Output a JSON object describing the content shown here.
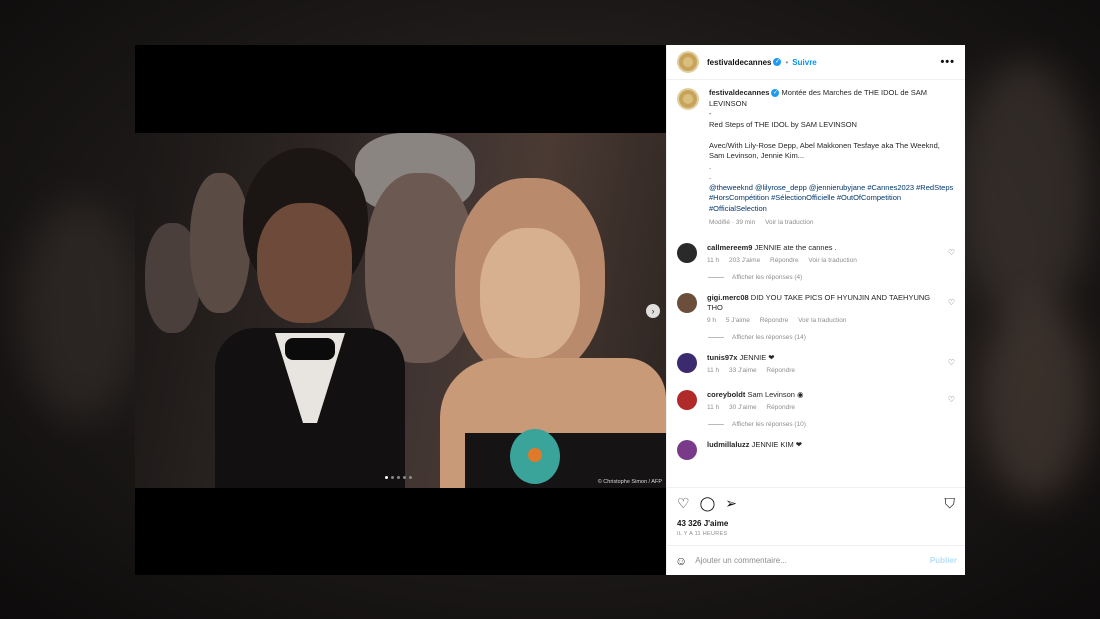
{
  "post": {
    "account": "festivaldecannes",
    "follow_label": "Suivre",
    "more_label": "•••",
    "photo_credit": "© Christophe Simon / AFP"
  },
  "caption": {
    "username": "festivaldecannes",
    "line1": " Montée des Marches de THE IDOL de SAM LEVINSON",
    "sep1": "-",
    "line2": "Red Steps of THE IDOL by SAM LEVINSON",
    "line3": "Avec/With Lily-Rose Depp, Abel Makkonen Tesfaye aka The Weeknd, Sam Levinson, Jennie Kim...",
    "sep2": ".",
    "sep3": ".",
    "tags": "@theweeknd @lilyrose_depp @jennierubyjane #Cannes2023 #RedSteps #HorsCompétition #SélectionOfficielle #OutOfCompetition #OfficialSelection",
    "edited": "Modifié · 39 min",
    "see_translation": "Voir la traduction"
  },
  "comments": [
    {
      "user": "callmereem9",
      "text": "JENNIE ate the cannes .",
      "time": "11 h",
      "likes": "203 J'aime",
      "reply": "Répondre",
      "translate": "Voir la traduction",
      "replies": "Afficher les réponses (4)"
    },
    {
      "user": "gigi.merc08",
      "text": "DID YOU TAKE PICS OF HYUNJIN AND TAEHYUNG THO",
      "time": "9 h",
      "likes": "5 J'aime",
      "reply": "Répondre",
      "translate": "Voir la traduction",
      "replies": "Afficher les réponses (14)"
    },
    {
      "user": "tunis97x",
      "text": "JENNIE ❤",
      "time": "11 h",
      "likes": "33 J'aime",
      "reply": "Répondre"
    },
    {
      "user": "coreyboldt",
      "text": "Sam Levinson ◉",
      "time": "11 h",
      "likes": "30 J'aime",
      "reply": "Répondre",
      "replies": "Afficher les réponses (10)"
    },
    {
      "user": "ludmillaluzz",
      "text": "JENNIE KIM ❤"
    }
  ],
  "footer": {
    "likes": "43 326 J'aime",
    "ago": "IL Y A 11 HEURES",
    "comment_placeholder": "Ajouter un commentaire...",
    "post_label": "Publier"
  },
  "colors": {
    "accent": "#0095f6",
    "verified": "#1d9bf0",
    "heart": "#ed4956"
  }
}
